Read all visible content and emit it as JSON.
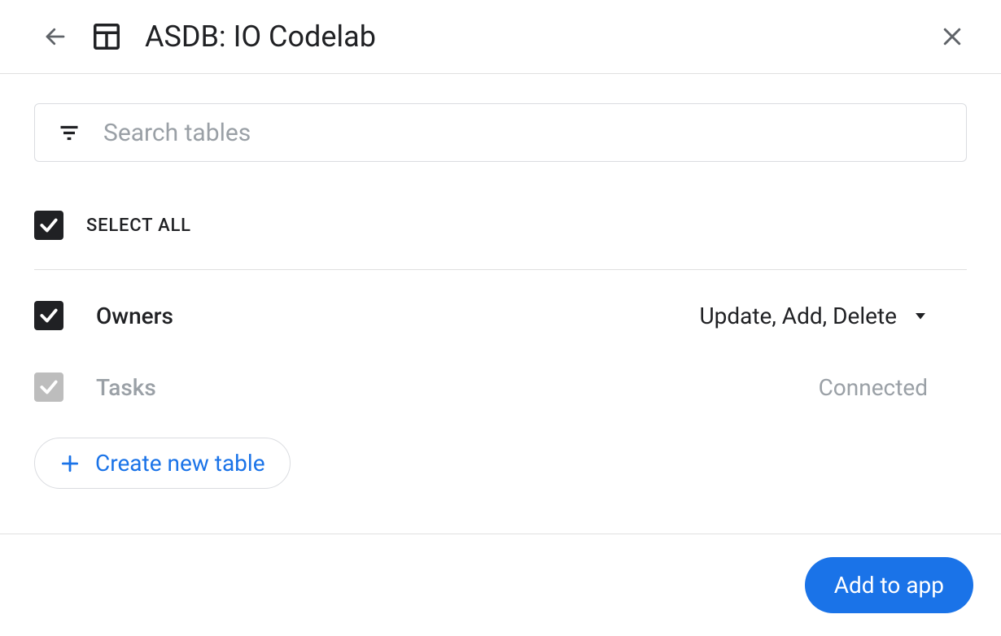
{
  "header": {
    "title": "ASDB: IO Codelab"
  },
  "search": {
    "placeholder": "Search tables",
    "value": ""
  },
  "select_all": {
    "label": "SELECT ALL",
    "checked": true
  },
  "tables": [
    {
      "name": "Owners",
      "checked": true,
      "disabled": false,
      "permissions": "Update, Add, Delete",
      "status": null
    },
    {
      "name": "Tasks",
      "checked": true,
      "disabled": true,
      "permissions": null,
      "status": "Connected"
    }
  ],
  "create_button": {
    "label": "Create new table"
  },
  "footer": {
    "primary_label": "Add to app"
  }
}
